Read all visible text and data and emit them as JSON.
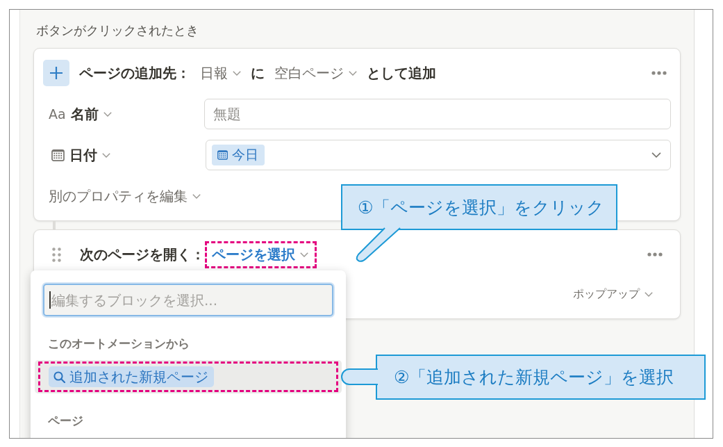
{
  "section_title": "ボタンがクリックされたとき",
  "actions": [
    {
      "kind": "add_page",
      "label": "ページの追加先：",
      "database": "日報",
      "connector": "に",
      "template": "空白ページ",
      "suffix": "として追加",
      "properties": [
        {
          "kind": "title",
          "icon_text": "Aa",
          "name": "名前",
          "placeholder": "無題"
        },
        {
          "kind": "date",
          "name": "日付",
          "chip": "今日"
        }
      ],
      "edit_more": "別のプロパティを編集"
    },
    {
      "kind": "open_page",
      "label": "次のページを開く：",
      "target": {
        "label": "ページを選択",
        "highlighted": true
      },
      "mode": "ポップアップ"
    }
  ],
  "dropdown": {
    "search_placeholder": "編集するブロックを選択...",
    "sections": [
      {
        "title": "このオートメーションから",
        "items": [
          {
            "label": "追加された新規ページ",
            "selected": true,
            "highlighted": true
          }
        ]
      },
      {
        "title": "ページ"
      }
    ]
  },
  "callouts": [
    {
      "text": "①「ページを選択」をクリック"
    },
    {
      "text": "②「追加された新規ページ」を選択"
    }
  ]
}
